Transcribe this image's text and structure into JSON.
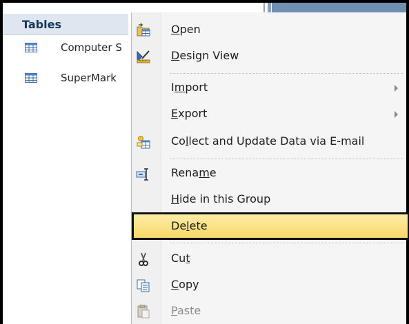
{
  "nav": {
    "group_title": "Tables",
    "items": [
      {
        "label": "Computer S",
        "icon": "table-icon"
      },
      {
        "label": "SuperMark",
        "icon": "table-icon"
      }
    ]
  },
  "menu": {
    "items": [
      {
        "name": "open",
        "pre": "",
        "key": "O",
        "post": "pen",
        "icon": "open-table-icon"
      },
      {
        "name": "design-view",
        "pre": "",
        "key": "D",
        "post": "esign View",
        "icon": "design-view-icon"
      },
      {
        "name": "import",
        "pre": "I",
        "key": "m",
        "post": "port",
        "icon": null,
        "submenu": true
      },
      {
        "name": "export",
        "pre": "",
        "key": "E",
        "post": "xport",
        "icon": null,
        "submenu": true
      },
      {
        "name": "collect",
        "pre": "Co",
        "key": "l",
        "post": "lect and Update Data via E-mail",
        "icon": "collect-data-icon"
      },
      {
        "name": "rename",
        "pre": "Rena",
        "key": "m",
        "post": "e",
        "icon": "rename-icon"
      },
      {
        "name": "hide",
        "pre": "",
        "key": "H",
        "post": "ide in this Group",
        "icon": null
      },
      {
        "name": "delete",
        "pre": "De",
        "key": "l",
        "post": "ete",
        "icon": null,
        "highlighted": true
      },
      {
        "name": "cut",
        "pre": "Cu",
        "key": "t",
        "post": "",
        "icon": "cut-icon"
      },
      {
        "name": "copy",
        "pre": "",
        "key": "C",
        "post": "opy",
        "icon": "copy-icon"
      },
      {
        "name": "paste",
        "pre": "",
        "key": "P",
        "post": "aste",
        "icon": "paste-icon",
        "disabled": true
      }
    ]
  },
  "colors": {
    "highlight_top": "#fdeda4",
    "highlight_bottom": "#f9d86a",
    "nav_header_bg": "#dfe6ef",
    "nav_header_text": "#14365d"
  }
}
